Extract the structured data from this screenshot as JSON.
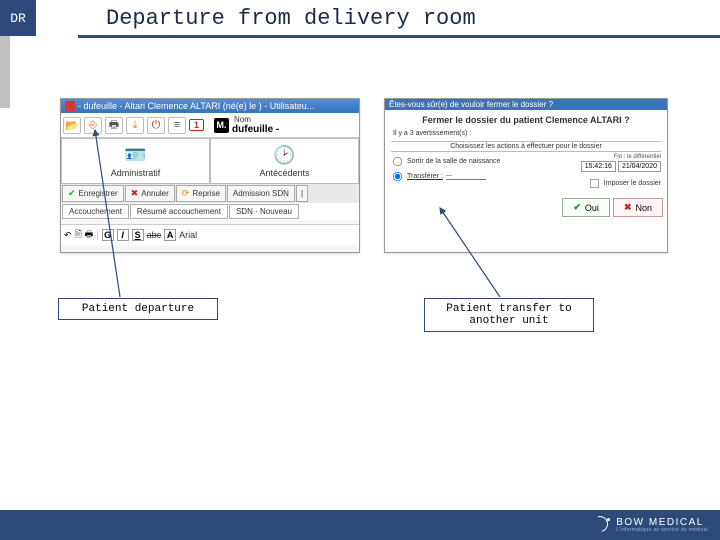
{
  "header": {
    "badge": "DR",
    "title": "Departure from delivery room"
  },
  "leftWindow": {
    "title": "- dufeuille - Altari Clemence ALTARI (né(e) le ) - Utilisateu...",
    "badge": "1",
    "m": "M.",
    "nomLabel": "Nom",
    "nomValue": "dufeuille -",
    "tabs": {
      "admin": "Administratif",
      "ante": "Antécédents"
    },
    "btns": {
      "save": "Enregistrer",
      "cancel": "Annuler",
      "reprise": "Reprise",
      "adm": "Admission SDN"
    },
    "tabrow": {
      "acc": "Accouchement",
      "res": "Résumé accouchement",
      "sdn": "SDN - Nouveau"
    },
    "fmt": {
      "g": "G",
      "i": "I",
      "s": "S",
      "abc": "abc",
      "a": "A",
      "font": "Arial"
    }
  },
  "dialog": {
    "question": "Êtes-vous sûr(e) de vouloir fermer le dossier ?",
    "title": "Fermer le dossier du patient Clemence ALTARI ?",
    "warningsHead": "Il y a 3 avertissement(s) :",
    "section": "Choisissez les actions à effectuer pour le dossier",
    "opt1": "Sortir de la salle de naissance",
    "opt2": "Transférer :",
    "timeLabel": "Fin :  le différentiel",
    "time": "15:42:16",
    "date": "21/04/2020",
    "impose": "Imposer le dossier",
    "yes": "Oui",
    "no": "Non"
  },
  "callouts": {
    "departure": "Patient departure",
    "transfer": "Patient transfer to\nanother unit"
  },
  "footer": {
    "brand": "BOW MEDICAL",
    "tagline": "L'informatique au service du médical"
  }
}
